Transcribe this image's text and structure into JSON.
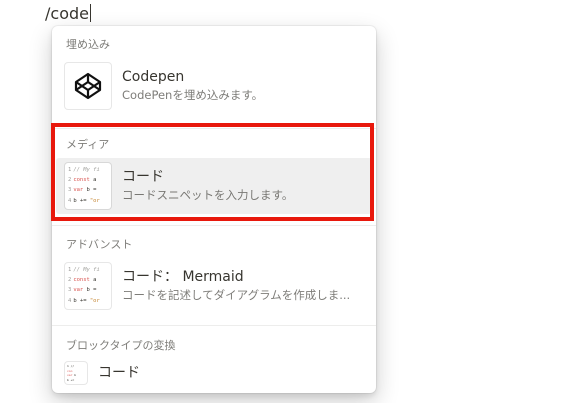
{
  "editor": {
    "typed_text": "/code"
  },
  "menu": {
    "sections": {
      "embed": {
        "header": "埋め込み",
        "items": [
          {
            "title": "Codepen",
            "description": "CodePenを埋め込みます。",
            "icon": "codepen-icon"
          }
        ]
      },
      "media": {
        "header": "メディア",
        "items": [
          {
            "title": "コード",
            "description": "コードスニペットを入力します。",
            "icon": "code-snippet-icon"
          }
        ]
      },
      "advanced": {
        "header": "アドバンスト",
        "items": [
          {
            "title": "コード： Mermaid",
            "description": "コードを記述してダイアグラムを作成しま...",
            "icon": "code-snippet-icon"
          }
        ]
      },
      "turn_into": {
        "header": "ブロックタイプの変換",
        "items": [
          {
            "title": "コード",
            "icon": "code-block-icon"
          }
        ]
      }
    },
    "code_thumb_lines": [
      {
        "ln": "1",
        "text": "// My fi"
      },
      {
        "ln": "2",
        "kw": "const",
        "text": " a"
      },
      {
        "ln": "3",
        "kw": "var",
        "text": " b ="
      },
      {
        "ln": "4",
        "text": "b += ",
        "str": "\"or"
      }
    ]
  },
  "colors": {
    "highlight_border": "#e8180c",
    "selected_background": "#efefee",
    "text": "#37352f"
  }
}
